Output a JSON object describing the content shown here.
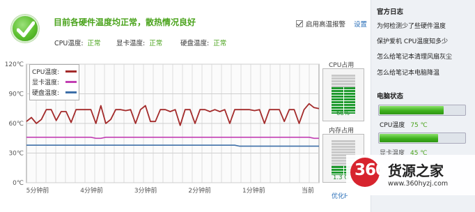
{
  "header": {
    "status_title": "目前各硬件温度均正常，散热情况良好",
    "cpu_label": "CPU温度:",
    "cpu_status": "正常",
    "gpu_label": "显卡温度:",
    "gpu_status": "正常",
    "disk_label": "硬盘温度:",
    "disk_status": "正常",
    "alarm_label": "启用高温报警",
    "alarm_checked": true,
    "settings_link": "设置"
  },
  "legend": {
    "cpu": "CPU温度:",
    "gpu": "显卡温度:",
    "disk": "硬盘温度:"
  },
  "chart_data": {
    "type": "line",
    "title": "",
    "xlabel": "",
    "ylabel": "",
    "y_ticks": [
      "120℃",
      "90℃",
      "60℃",
      "30℃",
      "0℃"
    ],
    "ylim": [
      0,
      120
    ],
    "x_ticks": [
      "5分钟前",
      "4分钟前",
      "3分钟前",
      "2分钟前",
      "1分钟前",
      "当前"
    ],
    "x_points": 60,
    "grid": true,
    "legend_position": "top-left",
    "colors": {
      "cpu": "#a32a2a",
      "gpu": "#c23fb3",
      "disk": "#3d6fa8"
    },
    "series": [
      {
        "name": "CPU温度",
        "values": [
          62,
          66,
          60,
          64,
          74,
          74,
          63,
          72,
          72,
          61,
          74,
          74,
          74,
          74,
          60,
          78,
          60,
          64,
          74,
          74,
          73,
          74,
          60,
          74,
          78,
          62,
          62,
          74,
          74,
          72,
          74,
          58,
          74,
          74,
          60,
          74,
          74,
          72,
          74,
          72,
          74,
          60,
          74,
          74,
          74,
          74,
          73,
          74,
          60,
          74,
          74,
          74,
          62,
          74,
          74,
          60,
          74,
          80,
          76,
          75
        ]
      },
      {
        "name": "显卡温度",
        "values": [
          46,
          46,
          46,
          46,
          46,
          46,
          46,
          46,
          46,
          46,
          46,
          46,
          46,
          46,
          45,
          45,
          46,
          46,
          46,
          46,
          46,
          46,
          46,
          46,
          46,
          46,
          46,
          46,
          46,
          46,
          46,
          46,
          46,
          46,
          46,
          46,
          46,
          46,
          46,
          46,
          46,
          46,
          46,
          46,
          46,
          46,
          46,
          46,
          46,
          46,
          46,
          46,
          46,
          46,
          46,
          46,
          46,
          46,
          45,
          45
        ]
      },
      {
        "name": "硬盘温度",
        "values": [
          38,
          38,
          38,
          38,
          38,
          38,
          38,
          38,
          38,
          38,
          38,
          38,
          38,
          38,
          38,
          38,
          38,
          38,
          38,
          38,
          38,
          38,
          38,
          38,
          38,
          38,
          38,
          38,
          38,
          38,
          38,
          38,
          38,
          38,
          38,
          38,
          38,
          38,
          38,
          38,
          38,
          38,
          38,
          37,
          37,
          37,
          37,
          37,
          37,
          37,
          37,
          37,
          37,
          37,
          37,
          37,
          37,
          37,
          37,
          37
        ]
      }
    ]
  },
  "gauges": {
    "cpu_title": "CPU占用",
    "cpu_percent_text": "68%",
    "cpu_fraction": 0.68,
    "mem_title": "内存占用",
    "mem_text": "1.3 G",
    "mem_fraction": 0.26,
    "optimize_link": "优化P"
  },
  "right_panel": {
    "news_title": "官方日志",
    "news_items": [
      "为何检测少了些硬件温度",
      "保护爱机 CPU温度知多少",
      "怎么给笔记本清理风扇灰尘",
      "怎么给笔记本电脑降温"
    ],
    "status_title": "电脑状态",
    "bar1_fraction": 0.74,
    "cpu_temp_label": "CPU温度",
    "cpu_temp_value": "75 ℃",
    "bar2_fraction": 0.68,
    "gpu_temp_label": "显卡温度",
    "gpu_temp_value": "45 ℃"
  },
  "watermark": {
    "number": "360",
    "name": "货源之家",
    "url": "www.360hyzj.com"
  }
}
